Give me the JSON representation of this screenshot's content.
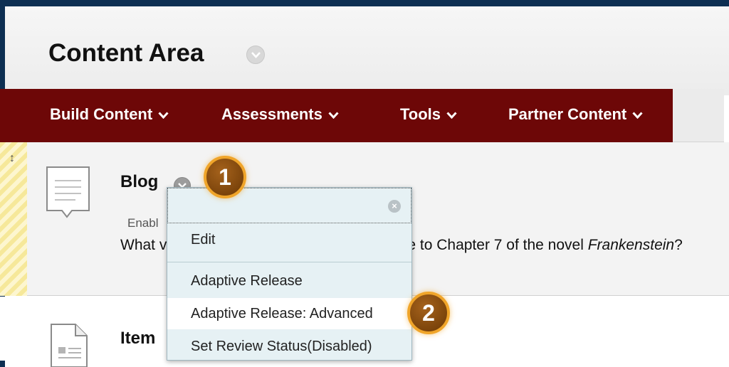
{
  "page": {
    "title": "Content Area"
  },
  "menu_bar": {
    "items": [
      {
        "label": "Build Content"
      },
      {
        "label": "Assessments"
      },
      {
        "label": "Tools"
      },
      {
        "label": "Partner Content"
      }
    ]
  },
  "content": {
    "blog": {
      "title": "Blog",
      "status": "Enabl",
      "desc_start": "What v",
      "desc_middle": "e to Chapter 7 of the novel ",
      "desc_italic": "Frankenstein",
      "desc_end": "?"
    },
    "item": {
      "title": "Item"
    }
  },
  "context_menu": {
    "items": [
      {
        "label": "Edit"
      },
      {
        "label": "Adaptive Release"
      },
      {
        "label": "Adaptive Release: Advanced"
      },
      {
        "label": "Set Review Status(Disabled)"
      }
    ]
  },
  "callouts": {
    "one": "1",
    "two": "2"
  },
  "colors": {
    "menu_bar_bg": "#6d0707",
    "context_menu_bg": "#e6f1f4",
    "callout_border": "#f0a52a"
  },
  "icons": [
    "chevron-down-icon",
    "blog-icon",
    "document-icon",
    "close-icon",
    "drag-handle-icon"
  ]
}
